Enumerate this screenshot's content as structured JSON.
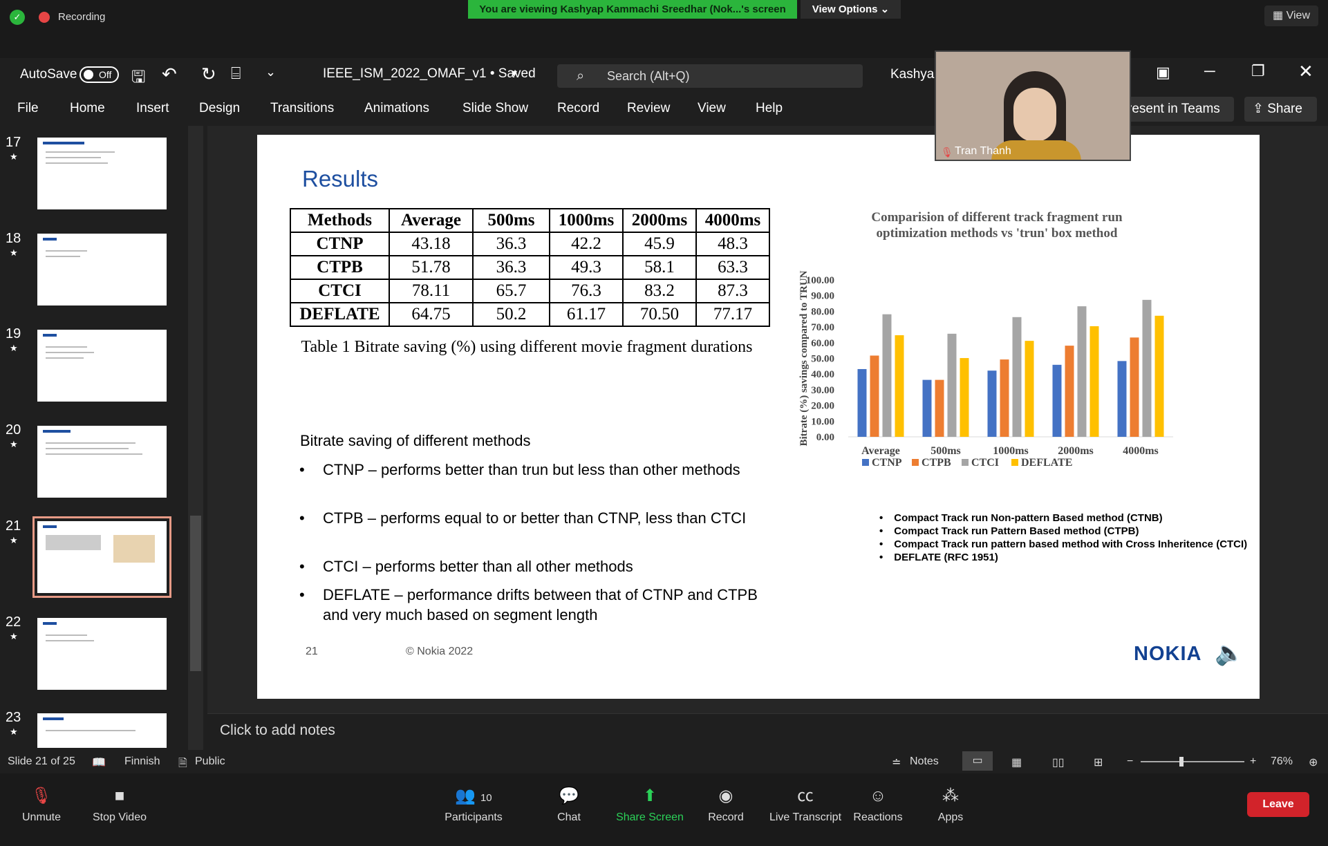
{
  "zoom_top": {
    "recording": "Recording",
    "share_banner": "You are viewing Kashyap Kammachi Sreedhar (Nok...'s screen",
    "view_options": "View Options ⌄",
    "view": "View"
  },
  "titlebar": {
    "autosave": "AutoSave",
    "autosave_state": "Off",
    "filename": "IEEE_ISM_2022_OMAF_v1 • Saved",
    "search": "Search (Alt+Q)",
    "user": "Kashyap"
  },
  "ribbon": {
    "tabs": [
      "File",
      "Home",
      "Insert",
      "Design",
      "Transitions",
      "Animations",
      "Slide Show",
      "Record",
      "Review",
      "View",
      "Help"
    ],
    "present_teams": "resent in Teams",
    "share": "Share"
  },
  "thumbnails": [
    "17",
    "18",
    "19",
    "20",
    "21",
    "22",
    "23"
  ],
  "slide": {
    "title": "Results",
    "table": {
      "headers": [
        "Methods",
        "Average",
        "500ms",
        "1000ms",
        "2000ms",
        "4000ms"
      ],
      "rows": [
        [
          "CTNP",
          "43.18",
          "36.3",
          "42.2",
          "45.9",
          "48.3"
        ],
        [
          "CTPB",
          "51.78",
          "36.3",
          "49.3",
          "58.1",
          "63.3"
        ],
        [
          "CTCI",
          "78.11",
          "65.7",
          "76.3",
          "83.2",
          "87.3"
        ],
        [
          "DEFLATE",
          "64.75",
          "50.2",
          "61.17",
          "70.50",
          "77.17"
        ]
      ]
    },
    "caption": "Table 1 Bitrate saving (%) using different movie fragment durations",
    "bullets_title": "Bitrate saving of different methods",
    "bullets": [
      "CTNP – performs better than trun but less than other methods",
      "CTPB – performs equal to or better than CTNP, less than CTCI",
      "CTCI – performs better than all other methods",
      "DEFLATE – performance drifts between that of CTNP and CTPB and very much based on segment length"
    ],
    "legend_notes": [
      "Compact Track run Non-pattern Based method (CTNB)",
      "Compact Track run Pattern Based method (CTPB)",
      "Compact Track run pattern based method with Cross Inheritence (CTCI)",
      "DEFLATE (RFC 1951)"
    ],
    "slide_number": "21",
    "copyright": "© Nokia 2022",
    "logo": "NOKIA"
  },
  "chart_data": {
    "type": "bar",
    "title": "Comparision of different track fragment run optimization methods vs 'trun' box method",
    "ylabel": "Bitrate (%) savings compared to TRUN",
    "xlabel": "",
    "categories": [
      "Average",
      "500ms",
      "1000ms",
      "2000ms",
      "4000ms"
    ],
    "ylim": [
      0,
      100
    ],
    "yticks": [
      "0.00",
      "10.00",
      "20.00",
      "30.00",
      "40.00",
      "50.00",
      "60.00",
      "70.00",
      "80.00",
      "90.00",
      "100.00"
    ],
    "series": [
      {
        "name": "CTNP",
        "color": "#4472c4",
        "values": [
          43.18,
          36.3,
          42.2,
          45.9,
          48.3
        ]
      },
      {
        "name": "CTPB",
        "color": "#ed7d31",
        "values": [
          51.78,
          36.3,
          49.3,
          58.1,
          63.3
        ]
      },
      {
        "name": "CTCI",
        "color": "#a5a5a5",
        "values": [
          78.11,
          65.7,
          76.3,
          83.2,
          87.3
        ]
      },
      {
        "name": "DEFLATE",
        "color": "#ffc000",
        "values": [
          64.75,
          50.2,
          61.17,
          70.5,
          77.17
        ]
      }
    ],
    "legend_position": "bottom",
    "grid": false
  },
  "camera": {
    "name": "Tran Thanh"
  },
  "notes": "Click to add notes",
  "statusbar": {
    "slide": "Slide 21 of 25",
    "language": "Finnish",
    "sensitivity": "Public",
    "notes": "Notes",
    "zoom": "76%"
  },
  "zoom_bottom": {
    "unmute": "Unmute",
    "stop_video": "Stop Video",
    "participants": "Participants",
    "participants_count": "10",
    "chat": "Chat",
    "share_screen": "Share Screen",
    "record": "Record",
    "live_transcript": "Live Transcript",
    "reactions": "Reactions",
    "apps": "Apps",
    "leave": "Leave"
  }
}
